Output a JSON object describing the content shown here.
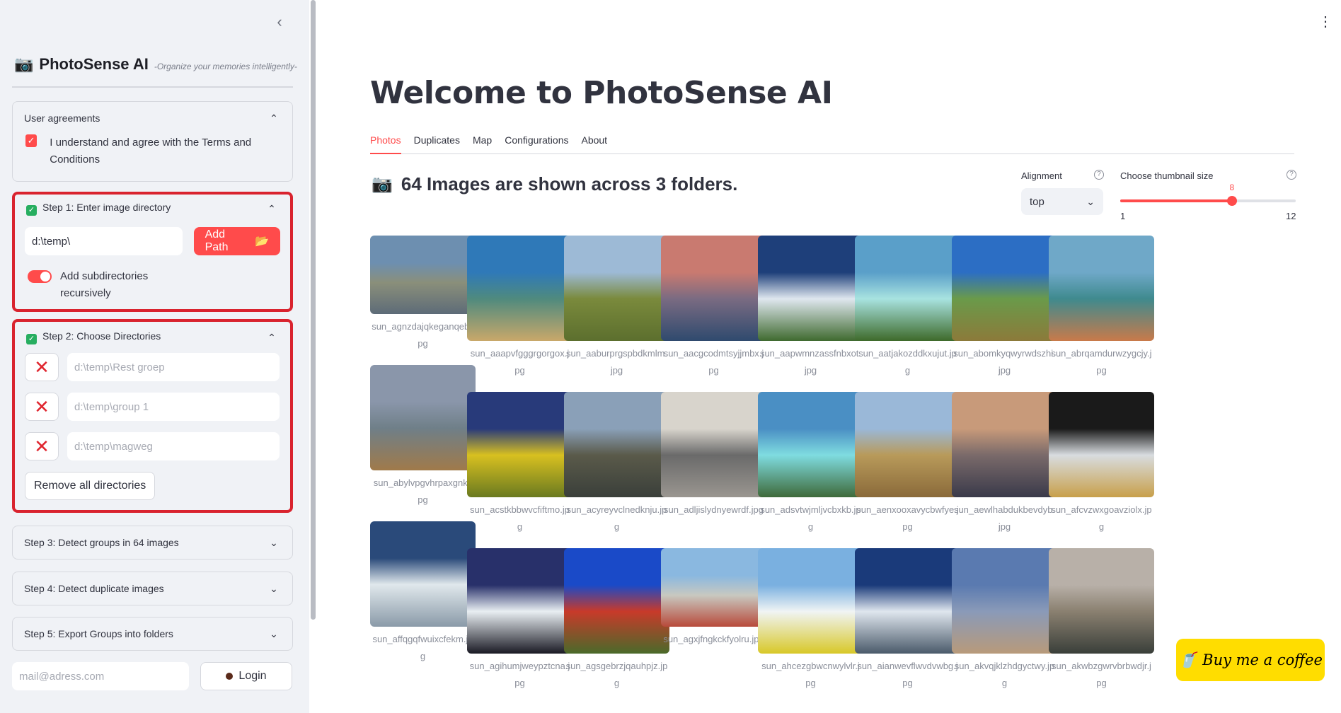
{
  "sidebar": {
    "brand_name": "PhotoSense AI",
    "brand_tagline": "-Organize your memories intelligently-",
    "agreements": {
      "title": "User agreements",
      "text": "I understand and agree with the Terms and Conditions"
    },
    "step1": {
      "title": "Step 1: Enter image directory",
      "input_value": "d:\\temp\\",
      "add_path_label": "Add Path",
      "toggle_label": "Add subdirectories recursively"
    },
    "step2": {
      "title": "Step 2: Choose Directories",
      "directories": [
        "d:\\temp\\Rest groep",
        "d:\\temp\\group 1",
        "d:\\temp\\magweg"
      ],
      "remove_all_label": "Remove all directories"
    },
    "step3": {
      "title": "Step 3: Detect groups in 64 images"
    },
    "step4": {
      "title": "Step 4: Detect duplicate images"
    },
    "step5": {
      "title": "Step 5: Export Groups into folders"
    },
    "email_placeholder": "mail@adress.com",
    "login_label": "Login"
  },
  "main": {
    "title": "Welcome to PhotoSense AI",
    "tabs": [
      "Photos",
      "Duplicates",
      "Map",
      "Configurations",
      "About"
    ],
    "active_tab": "Photos",
    "summary": "64 Images are shown across 3 folders.",
    "alignment": {
      "label": "Alignment",
      "value": "top"
    },
    "thumb_size": {
      "label": "Choose thumbnail size",
      "value": "8",
      "min": "1",
      "max": "12"
    },
    "coffee_label": "Buy me a coffee",
    "images": [
      {
        "name": "sun_agnzdajqkeganqeb.jpg",
        "colors": [
          "#6d8fb0",
          "#8a8f7a",
          "#5d6b78"
        ]
      },
      {
        "name": "sun_aaapvfgggrgorgox.jpg",
        "colors": [
          "#2f79b8",
          "#4f8a7e",
          "#c9a86a"
        ]
      },
      {
        "name": "sun_aaburprgspbdkmlm.jpg",
        "colors": [
          "#9dbad6",
          "#7a8a3c",
          "#5c6f2e"
        ]
      },
      {
        "name": "sun_aacgcodmtsyjjmbx.jpg",
        "colors": [
          "#c97a70",
          "#7a6b82",
          "#2f4a6e"
        ]
      },
      {
        "name": "sun_aapwmnzassfnbxot.jpg",
        "colors": [
          "#1e3f7a",
          "#dfe7ef",
          "#3f6a2f"
        ]
      },
      {
        "name": "sun_aatjakozddkxujut.jpg",
        "colors": [
          "#5a9fc9",
          "#a8e3e0",
          "#3e6a2a"
        ]
      },
      {
        "name": "sun_abomkyqwyrwdszhi.jpg",
        "colors": [
          "#2c6ec4",
          "#6a9a4a",
          "#8c7a3a"
        ]
      },
      {
        "name": "sun_abrqamdurwzygcjy.jpg",
        "colors": [
          "#6fa8c8",
          "#3f8a8e",
          "#c97a4a"
        ]
      },
      {
        "name": "sun_abylvpgvhrpaxgnk.jpg",
        "colors": [
          "#8a96aa",
          "#6f7f88",
          "#a07a4a"
        ]
      },
      {
        "name": "sun_acstkbbwvcfiftmo.jpg",
        "colors": [
          "#283a7a",
          "#d8c020",
          "#6a7a20"
        ]
      },
      {
        "name": "sun_acyreyvclnedknju.jpg",
        "colors": [
          "#8aa0b8",
          "#5a5a4a",
          "#3a3f3a"
        ]
      },
      {
        "name": "sun_adljislydnyewrdf.jpg",
        "colors": [
          "#d8d4cc",
          "#6a6a6a",
          "#9a9690"
        ]
      },
      {
        "name": "sun_adsvtwjmljvcbxkb.jpg",
        "colors": [
          "#4a8fc4",
          "#7fdce0",
          "#3f6a3a"
        ]
      },
      {
        "name": "sun_aenxooxavycbwfye.jpg",
        "colors": [
          "#9ab8d8",
          "#b89a5a",
          "#8a6a3a"
        ]
      },
      {
        "name": "sun_aewlhabdukbevdyb.jpg",
        "colors": [
          "#c89a7a",
          "#7a6a6a",
          "#3a3a4a"
        ]
      },
      {
        "name": "sun_afcvzwxgoavziolx.jpg",
        "colors": [
          "#1a1a1a",
          "#d8dce0",
          "#c8a04a"
        ]
      },
      {
        "name": "sun_affqgqfwuixcfekm.jpg",
        "colors": [
          "#2a4a7a",
          "#e0e8ec",
          "#8a9aa8"
        ]
      },
      {
        "name": "sun_agihumjweypztcna.jpg",
        "colors": [
          "#28306a",
          "#e8eef2",
          "#1a1a24"
        ]
      },
      {
        "name": "sun_agsgebrzjqauhpjz.jpg",
        "colors": [
          "#1a4ac8",
          "#c83a2a",
          "#4a6a2a"
        ]
      },
      {
        "name": "sun_agxjfngkckfyolru.jpg",
        "colors": [
          "#8ab8e0",
          "#c8c8c0",
          "#b84a3a"
        ]
      },
      {
        "name": "sun_ahcezgbwcnwylvlr.jpg",
        "colors": [
          "#7ab0e0",
          "#f0f4f4",
          "#d8c828"
        ]
      },
      {
        "name": "sun_aianwevflwvdvwbg.jpg",
        "colors": [
          "#1a3a7a",
          "#dfe6ee",
          "#4a5a6a"
        ]
      },
      {
        "name": "sun_akvqjklzhdgyctwy.jpg",
        "colors": [
          "#5a7ab0",
          "#8a9ab8",
          "#b89a7a"
        ]
      },
      {
        "name": "sun_akwbzgwrvbrbwdjr.jpg",
        "colors": [
          "#b8b0a8",
          "#8a8070",
          "#3a3f3a"
        ]
      }
    ]
  }
}
